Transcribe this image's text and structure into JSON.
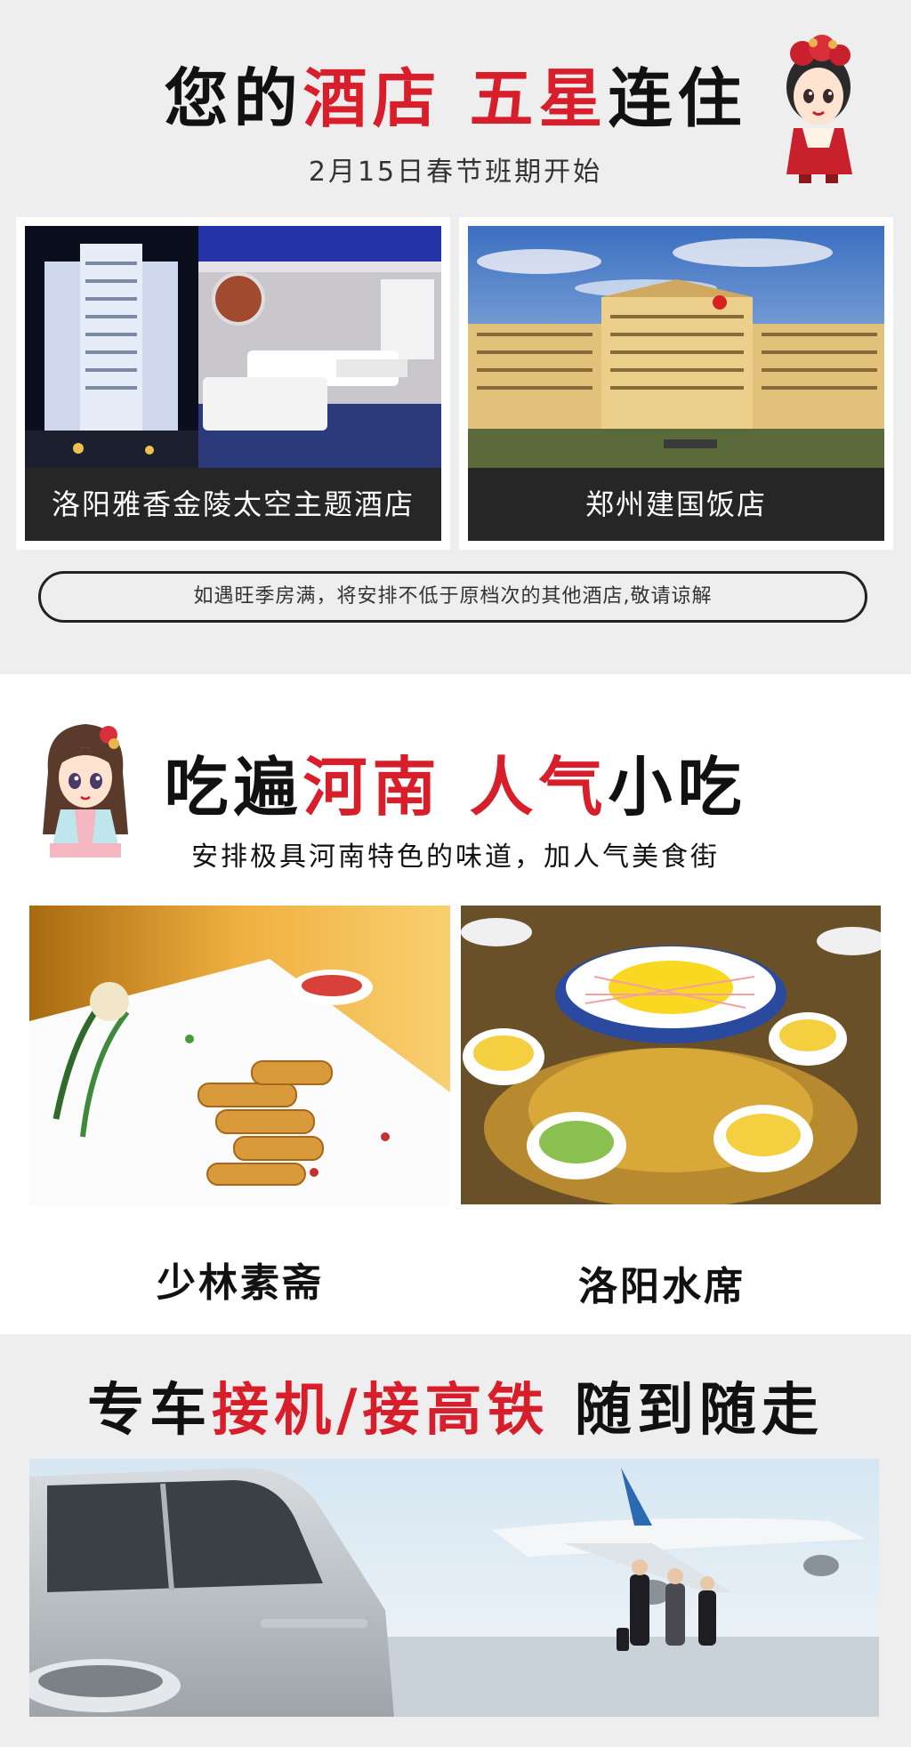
{
  "hotels": {
    "title_parts": {
      "a": "您的",
      "b": "酒店",
      "c": " 五星",
      "d": "连住"
    },
    "subtitle": "2月15日春节班期开始",
    "items": [
      {
        "name": "洛阳雅香金陵太空主题酒店"
      },
      {
        "name": "郑州建国饭店"
      }
    ],
    "notice": "如遇旺季房满，将安排不低于原档次的其他酒店,敬请谅解"
  },
  "food": {
    "title_parts": {
      "a": "吃遍",
      "b": "河南",
      "c": " 人气",
      "d": "小吃"
    },
    "subtitle": "安排极具河南特色的味道，加人气美食街",
    "items": [
      {
        "name": "少林素斋"
      },
      {
        "name": "洛阳水席"
      }
    ]
  },
  "transfer": {
    "title_parts": {
      "a": "专车",
      "b": "接机/接高铁",
      "c": " 随到随走"
    }
  },
  "colors": {
    "accent": "#d81e2a",
    "dark": "#262626",
    "bg_gray": "#eeeeee"
  },
  "icons": {
    "avatar1": "cartoon-woman-red-dress-icon",
    "avatar2": "cartoon-girl-hanfu-icon"
  }
}
